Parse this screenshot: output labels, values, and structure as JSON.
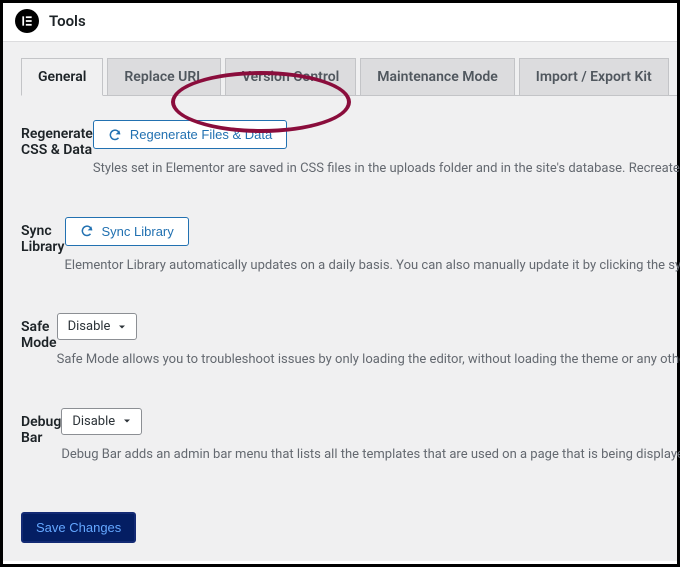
{
  "header": {
    "title": "Tools"
  },
  "tabs": [
    {
      "label": "General",
      "active": true
    },
    {
      "label": "Replace URL",
      "active": false
    },
    {
      "label": "Version Control",
      "active": false
    },
    {
      "label": "Maintenance Mode",
      "active": false
    },
    {
      "label": "Import / Export Kit",
      "active": false
    }
  ],
  "sections": {
    "regenerate": {
      "label": "Regenerate CSS & Data",
      "button": "Regenerate Files & Data",
      "desc": "Styles set in Elementor are saved in CSS files in the uploads folder and in the site's database. Recreate those files and settings, according to the most recent settings."
    },
    "sync": {
      "label": "Sync Library",
      "button": "Sync Library",
      "desc": "Elementor Library automatically updates on a daily basis. You can also manually update it by clicking the sync button."
    },
    "safemode": {
      "label": "Safe Mode",
      "value": "Disable",
      "desc": "Safe Mode allows you to troubleshoot issues by only loading the editor, without loading the theme or any other plugin."
    },
    "debugbar": {
      "label": "Debug Bar",
      "value": "Disable",
      "desc": "Debug Bar adds an admin bar menu that lists all the templates that are used on a page that is being displayed."
    }
  },
  "save_label": "Save Changes"
}
